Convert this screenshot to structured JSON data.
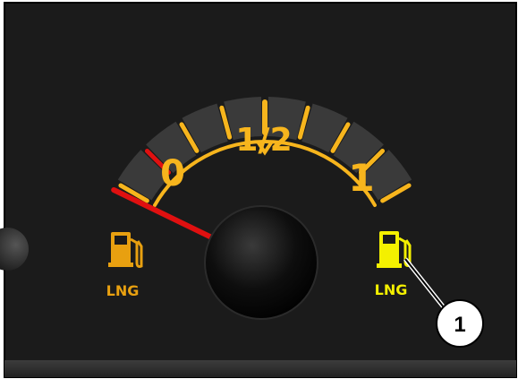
{
  "gauge": {
    "type": "fuel-gauge",
    "fuel_level": 0.0,
    "labels": {
      "empty": "0",
      "half": "1/2",
      "full": "1"
    },
    "tick_count": 9,
    "colors": {
      "panel": "#1b1b1b",
      "band": "#3a3a3a",
      "tick": "#f7b51d",
      "arc": "#f7b51d",
      "red_zone": "#e01010",
      "needle": "#e01010",
      "left_lamp": "#e8a010",
      "right_lamp": "#f4f000"
    }
  },
  "indicators": {
    "left": {
      "icon": "fuel-pump-icon",
      "label": "LNG",
      "state": "off"
    },
    "right": {
      "icon": "fuel-pump-icon",
      "label": "LNG",
      "state": "lit"
    }
  },
  "callout": {
    "number": "1"
  }
}
